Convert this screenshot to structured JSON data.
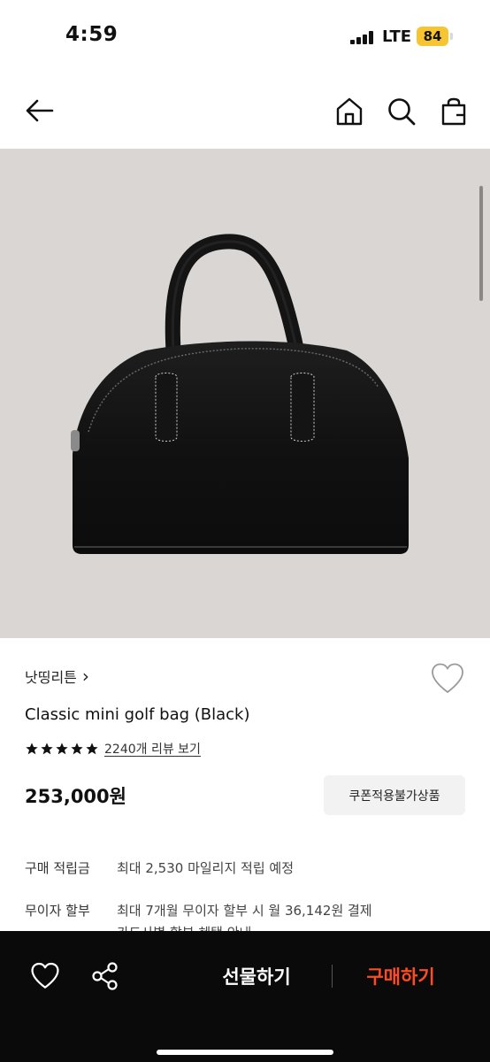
{
  "status_bar": {
    "time": "4:59",
    "network": "LTE",
    "battery": "84"
  },
  "nav": {
    "back_icon": "arrow-left-icon",
    "home_icon": "home-icon",
    "search_icon": "search-icon",
    "bag_icon": "shopping-bag-icon"
  },
  "product": {
    "image_icon": "black-handbag",
    "brand": "낫띵리튼",
    "brand_chevron": "›",
    "name": "Classic mini golf bag (Black)",
    "rating_stars": 5,
    "review_link": "2240개 리뷰 보기",
    "price": "253,000원",
    "coupon_label": "쿠폰적용불가상품"
  },
  "details": [
    {
      "label": "구매 적립금",
      "value": "최대 2,530 마일리지 적립 예정"
    },
    {
      "label": "무이자 할부",
      "value": "최대 7개월 무이자 할부 시 월 36,142원 결제"
    },
    {
      "label": "",
      "value": "카드사별 할부 혜택 안내"
    }
  ],
  "bottom_bar": {
    "wishlist_icon": "heart-icon",
    "share_icon": "share-icon",
    "gift_label": "선물하기",
    "buy_label": "구매하기"
  },
  "colors": {
    "accent": "#ff4b22",
    "bottom_bar_bg": "#0a0a0a",
    "battery": "#f7c531",
    "image_bg": "#d9d6d4"
  }
}
